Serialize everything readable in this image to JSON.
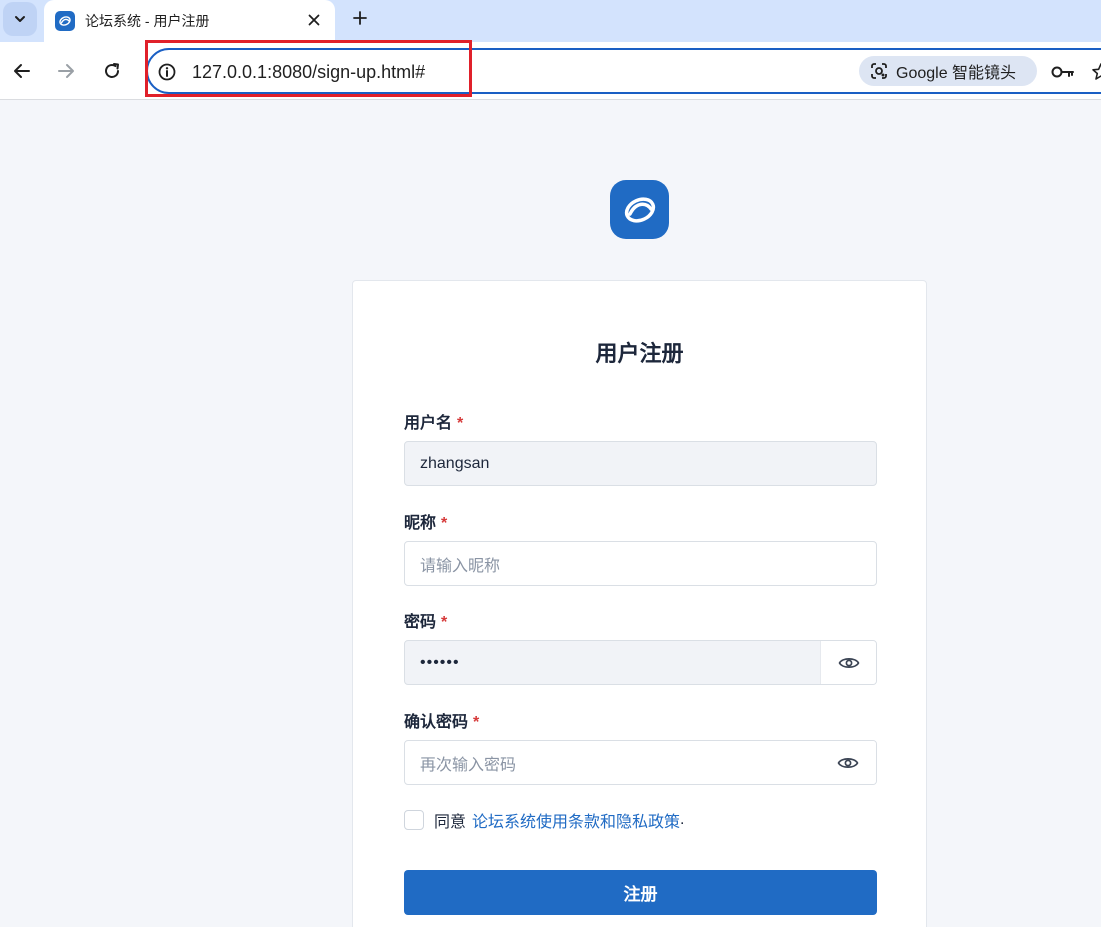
{
  "browser": {
    "tab": {
      "title": "论坛系统 - 用户注册"
    },
    "address_bar": {
      "url": "127.0.0.1:8080/sign-up.html#"
    },
    "lens_label": "Google 智能镜头",
    "icons": [
      "chevron-down-icon",
      "close-icon",
      "plus-icon",
      "back-arrow-icon",
      "forward-arrow-icon",
      "reload-icon",
      "info-icon",
      "lens-icon",
      "key-icon",
      "star-icon"
    ]
  },
  "accent_colors": {
    "primary": "#206bc4",
    "required": "#d63939",
    "highlight": "#e0202a"
  },
  "form": {
    "title": "用户注册",
    "required_mark": "*",
    "username": {
      "label": "用户名",
      "value": "zhangsan"
    },
    "nickname": {
      "label": "昵称",
      "placeholder": "请输入昵称"
    },
    "password": {
      "label": "密码",
      "value_masked": "••••••"
    },
    "confirm_password": {
      "label": "确认密码",
      "placeholder": "再次输入密码"
    },
    "agree": {
      "prefix": "同意",
      "link": "论坛系统使用条款和隐私政策",
      "suffix": "."
    },
    "submit_label": "注册"
  }
}
